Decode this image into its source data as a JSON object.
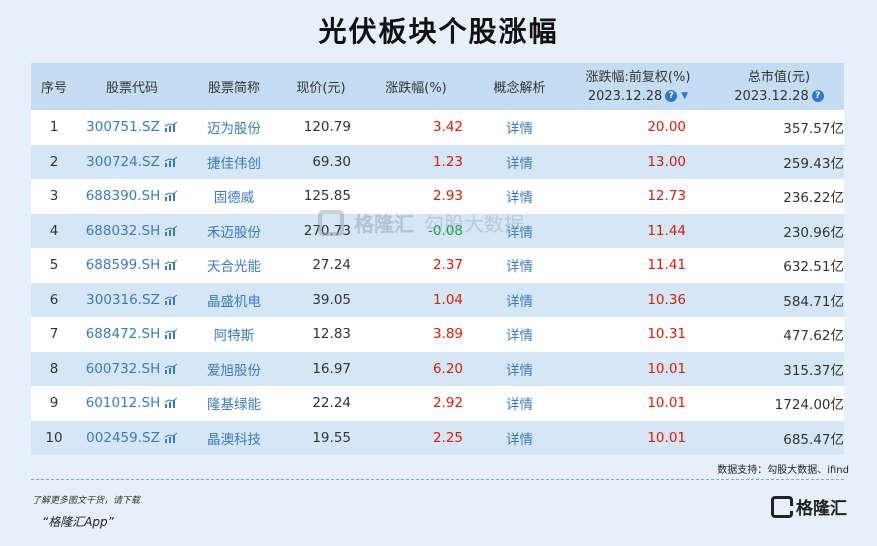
{
  "title": "光伏板块个股涨幅",
  "headers": {
    "no": "序号",
    "code": "股票代码",
    "name": "股票简称",
    "price": "现价(元)",
    "change": "涨跌幅(%)",
    "concept": "概念解析",
    "range_line1": "涨跌幅:前复权(%)",
    "range_line2": "2023.12.28",
    "cap_line1": "总市值(元)",
    "cap_line2": "2023.12.28"
  },
  "rows": [
    {
      "no": "1",
      "code": "300751.SZ",
      "name": "迈为股份",
      "price": "120.79",
      "change": "3.42",
      "dir": "up",
      "concept": "详情",
      "range": "20.00",
      "cap": "357.57亿"
    },
    {
      "no": "2",
      "code": "300724.SZ",
      "name": "捷佳伟创",
      "price": "69.30",
      "change": "1.23",
      "dir": "up",
      "concept": "详情",
      "range": "13.00",
      "cap": "259.43亿"
    },
    {
      "no": "3",
      "code": "688390.SH",
      "name": "固德威",
      "price": "125.85",
      "change": "2.93",
      "dir": "up",
      "concept": "详情",
      "range": "12.73",
      "cap": "236.22亿"
    },
    {
      "no": "4",
      "code": "688032.SH",
      "name": "禾迈股份",
      "price": "270.73",
      "change": "-0.08",
      "dir": "down",
      "concept": "详情",
      "range": "11.44",
      "cap": "230.96亿"
    },
    {
      "no": "5",
      "code": "688599.SH",
      "name": "天合光能",
      "price": "27.24",
      "change": "2.37",
      "dir": "up",
      "concept": "详情",
      "range": "11.41",
      "cap": "632.51亿"
    },
    {
      "no": "6",
      "code": "300316.SZ",
      "name": "晶盛机电",
      "price": "39.05",
      "change": "1.04",
      "dir": "up",
      "concept": "详情",
      "range": "10.36",
      "cap": "584.71亿"
    },
    {
      "no": "7",
      "code": "688472.SH",
      "name": "阿特斯",
      "price": "12.83",
      "change": "3.89",
      "dir": "up",
      "concept": "详情",
      "range": "10.31",
      "cap": "477.62亿"
    },
    {
      "no": "8",
      "code": "600732.SH",
      "name": "爱旭股份",
      "price": "16.97",
      "change": "6.20",
      "dir": "up",
      "concept": "详情",
      "range": "10.01",
      "cap": "315.37亿"
    },
    {
      "no": "9",
      "code": "601012.SH",
      "name": "隆基绿能",
      "price": "22.24",
      "change": "2.92",
      "dir": "up",
      "concept": "详情",
      "range": "10.01",
      "cap": "1724.00亿"
    },
    {
      "no": "10",
      "code": "002459.SZ",
      "name": "晶澳科技",
      "price": "19.55",
      "change": "2.25",
      "dir": "up",
      "concept": "详情",
      "range": "10.01",
      "cap": "685.47亿"
    }
  ],
  "source": "数据支持：勾股大数据、ifind",
  "promo_line1": "了解更多图文干货，请下载",
  "promo_line2": "“格隆汇App”",
  "logo_text": "格隆汇",
  "watermark_main": "格隆汇",
  "watermark_sub": "勾股大数据",
  "colors": {
    "up": "#d81e06",
    "down": "#1a9e3a",
    "link": "#3a7bbf",
    "header_bg": "#c5ddf2"
  }
}
